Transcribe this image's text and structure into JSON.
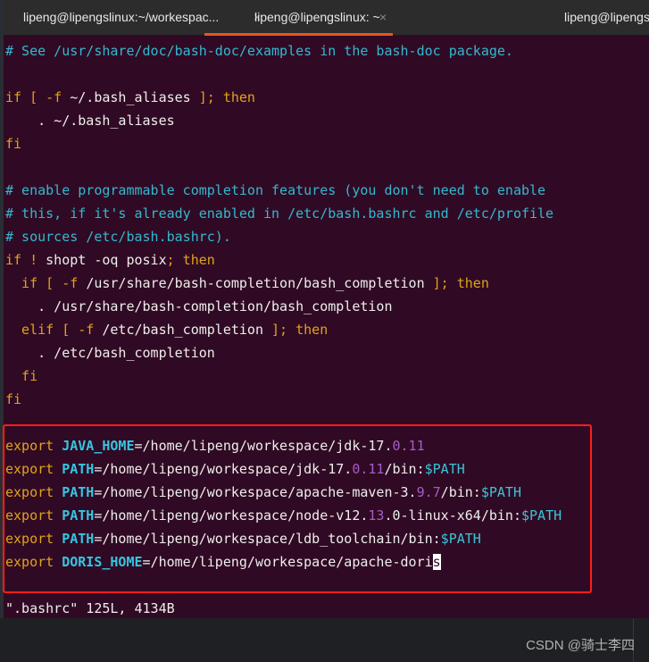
{
  "tabs": [
    {
      "label": "lipeng@lipengslinux:~/workespac...",
      "close": "×",
      "active": false
    },
    {
      "label": "lipeng@lipengslinux: ~",
      "close": "×",
      "active": true
    },
    {
      "label": "lipeng@lipengslinux",
      "active": false
    }
  ],
  "colors": {
    "background": "#300a24",
    "comment": "#34b8cf",
    "keyword": "#e0a31a",
    "variable": "#34c6e0",
    "number": "#a95bc8",
    "highlight_box": "#ff1e1e",
    "tab_accent": "#e95420"
  },
  "lines": [
    [
      [
        "c",
        "# See /usr/share/doc/bash-doc/examples in the bash-doc package."
      ]
    ],
    [],
    [
      [
        "y",
        "if [ -f "
      ],
      [
        "",
        "~/.bash_aliases "
      ],
      [
        "y",
        "]; then"
      ]
    ],
    [
      [
        "",
        "    . ~/.bash_aliases"
      ]
    ],
    [
      [
        "y",
        "fi"
      ]
    ],
    [],
    [
      [
        "c",
        "# enable programmable completion features (you don't need to enable"
      ]
    ],
    [
      [
        "c",
        "# this, if it's already enabled in /etc/bash.bashrc and /etc/profile"
      ]
    ],
    [
      [
        "c",
        "# sources /etc/bash.bashrc)."
      ]
    ],
    [
      [
        "y",
        "if ! "
      ],
      [
        "",
        "shopt -oq posix"
      ],
      [
        "y",
        "; then"
      ]
    ],
    [
      [
        "y",
        "  if [ -f "
      ],
      [
        "",
        "/usr/share/bash-completion/bash_completion "
      ],
      [
        "y",
        "]; then"
      ]
    ],
    [
      [
        "",
        "    . /usr/share/bash-completion/bash_completion"
      ]
    ],
    [
      [
        "y",
        "  elif [ -f "
      ],
      [
        "",
        "/etc/bash_completion "
      ],
      [
        "y",
        "]; then"
      ]
    ],
    [
      [
        "",
        "    . /etc/bash_completion"
      ]
    ],
    [
      [
        "y",
        "  fi"
      ]
    ],
    [
      [
        "y",
        "fi"
      ]
    ],
    [],
    [
      [
        "y",
        "export "
      ],
      [
        "b",
        "JAVA_HOME"
      ],
      [
        "",
        "=/home/lipeng/workespace/jdk-17."
      ],
      [
        "p",
        "0.11"
      ]
    ],
    [
      [
        "y",
        "export "
      ],
      [
        "b",
        "PATH"
      ],
      [
        "",
        "=/home/lipeng/workespace/jdk-17."
      ],
      [
        "p",
        "0.11"
      ],
      [
        "",
        "/bin:"
      ],
      [
        "v",
        "$PATH"
      ]
    ],
    [
      [
        "y",
        "export "
      ],
      [
        "b",
        "PATH"
      ],
      [
        "",
        "=/home/lipeng/workespace/apache-maven-3."
      ],
      [
        "p",
        "9.7"
      ],
      [
        "",
        "/bin:"
      ],
      [
        "v",
        "$PATH"
      ]
    ],
    [
      [
        "y",
        "export "
      ],
      [
        "b",
        "PATH"
      ],
      [
        "",
        "=/home/lipeng/workespace/node-v12."
      ],
      [
        "p",
        "13"
      ],
      [
        "",
        ".0-linux-x64/bin:"
      ],
      [
        "v",
        "$PATH"
      ]
    ],
    [
      [
        "y",
        "export "
      ],
      [
        "b",
        "PATH"
      ],
      [
        "",
        "=/home/lipeng/workespace/ldb_toolchain/bin:"
      ],
      [
        "v",
        "$PATH"
      ]
    ],
    [
      [
        "y",
        "export "
      ],
      [
        "b",
        "DORIS_HOME"
      ],
      [
        "",
        "=/home/lipeng/workespace/apache-dori"
      ],
      [
        "cursor",
        "s"
      ]
    ],
    [],
    [
      [
        "",
        "\".bashrc\" 125L, 4134B"
      ]
    ]
  ],
  "watermark": "CSDN @骑士李四"
}
